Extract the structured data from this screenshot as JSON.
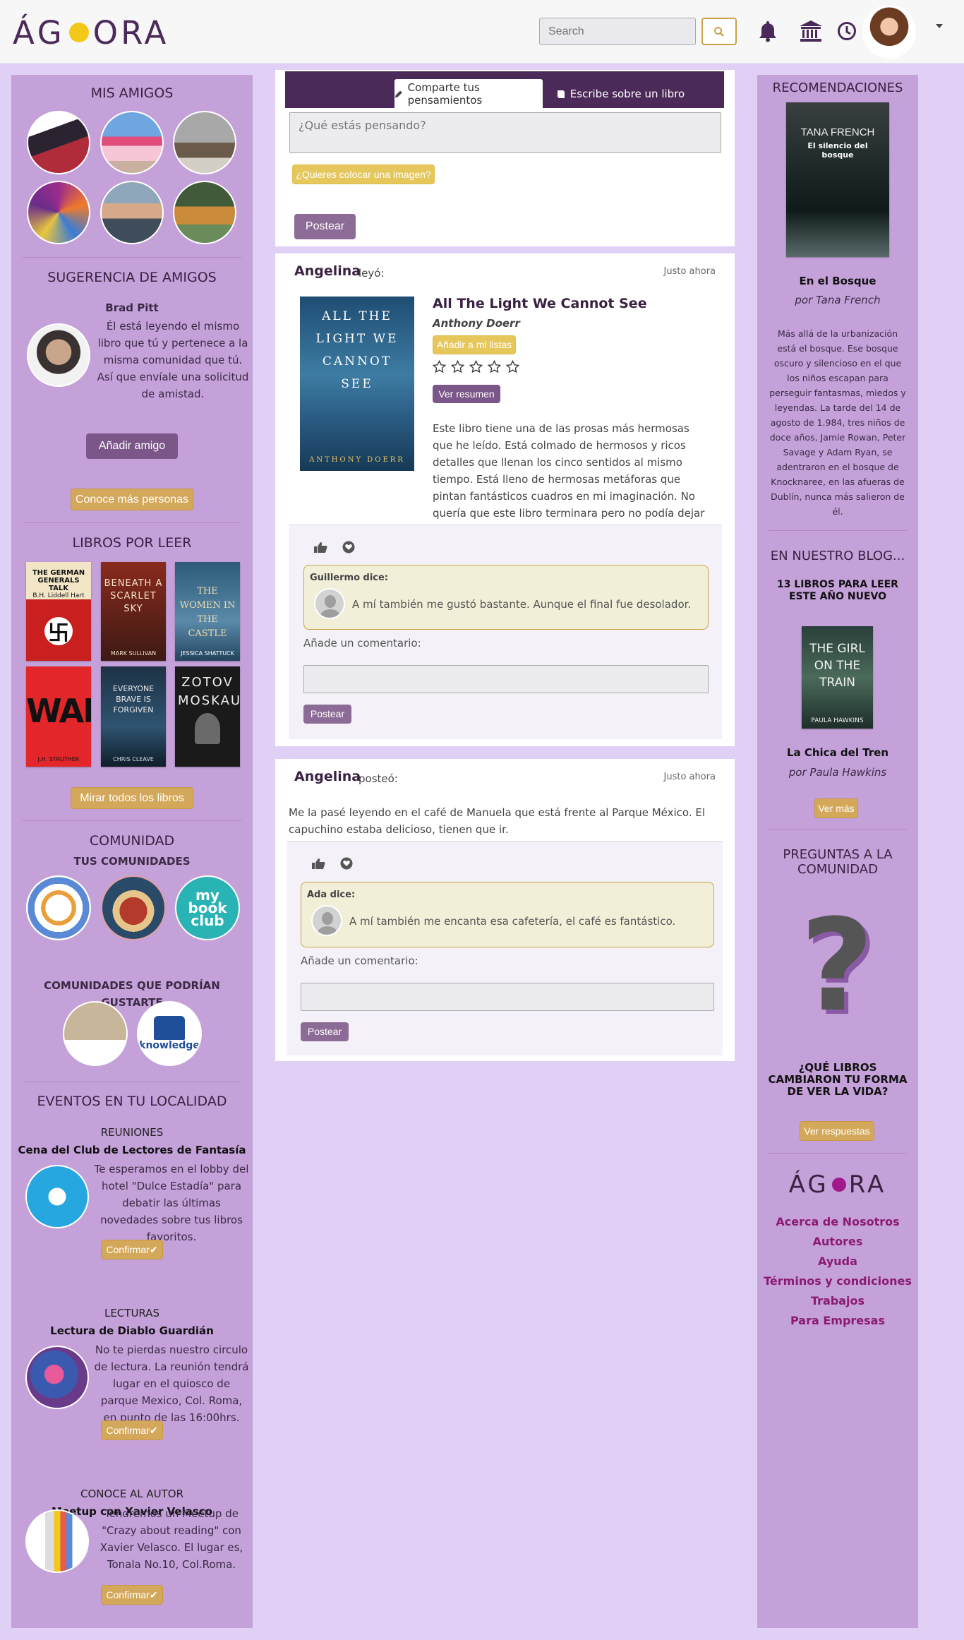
{
  "header": {
    "logo_text_left": "Á",
    "logo_text_right": "ORA",
    "search_placeholder": "Search"
  },
  "left": {
    "friends_title": "MIS AMIGOS",
    "suggest_title": "SUGERENCIA DE AMIGOS",
    "suggest_name": "Brad Pitt",
    "suggest_text": "Él está leyendo el mismo libro que tú y pertenece a la misma comunidad que tú. Así que envíale una solicitud de amistad.",
    "add_friend": "Añadir amigo",
    "meet_more": "Conoce más personas",
    "books_title": "LIBROS POR LEER",
    "books": [
      {
        "title": "THE GERMAN GENERALS TALK",
        "author": "B.H. Liddell Hart"
      },
      {
        "title": "BENEATH A SCARLET SKY",
        "author": "MARK SULLIVAN"
      },
      {
        "title": "THE WOMEN IN THE CASTLE",
        "author": "JESSICA SHATTUCK"
      },
      {
        "title": "WAR",
        "author": "J.H. STRUTHER"
      },
      {
        "title": "EVERYONE BRAVE IS FORGIVEN",
        "author": "CHRIS CLEAVE"
      },
      {
        "title": "ZOTOV MOSKAU",
        "author": ""
      }
    ],
    "see_all_books": "Mirar todos los libros",
    "community_title": "COMUNIDAD",
    "your_communities": "TUS COMUNIDADES",
    "community3_text": "my book club",
    "might_like": "COMUNIDADES QUE PODRÍAN GUSTARTE",
    "community5_text": "knowledge",
    "events_title": "EVENTOS EN TU LOCALIDAD",
    "events": [
      {
        "type": "REUNIONES",
        "name": "Cena del Club de Lectores de Fantasía",
        "text": "Te esperamos en el lobby del hotel \"Dulce Estadía\" para debatir las últimas novedades sobre tus libros favoritos.",
        "btn": "Confirmar✔"
      },
      {
        "type": "LECTURAS",
        "name": "Lectura de Diablo Guardián",
        "text": "No te pierdas nuestro circulo de lectura. La reunión tendrá lugar en el quiosco de parque Mexico, Col. Roma, en punto de las 16:00hrs.",
        "btn": "Confirmar✔"
      },
      {
        "type": "CONOCE AL AUTOR",
        "name": "Meetup con Xavier Velasco",
        "text": "Tendremos un Meetup de \"Crazy about reading\" con Xavier Velasco. El lugar es, Tonala No.10, Col.Roma.",
        "btn": "Confirmar✔"
      }
    ]
  },
  "composer": {
    "tab1": "Comparte tus pensamientos",
    "tab2": "Escribe sobre un libro",
    "placeholder": "¿Qué estás pensando?",
    "image_btn": "¿Quieres colocar una imagen?",
    "post_btn": "Postear"
  },
  "post1": {
    "author": "Angelina",
    "action": "leyó:",
    "time": "Justo ahora",
    "book_title": "All The Light We Cannot See",
    "book_author": "Anthony Doerr",
    "cover_title": "ALL THE LIGHT WE CANNOT SEE",
    "cover_author": "ANTHONY DOERR",
    "add_list": "Añadir a mi listas",
    "rating": 0,
    "summary_btn": "Ver resumen",
    "review": "Este libro tiene una de las prosas más hermosas que he leído. Está colmado de hermosos y ricos detalles que llenan los cinco sentidos al mismo tiempo. Está lleno de hermosas metáforas que pintan fantásticos cuadros en mi imaginación. No quería que este libro terminara pero no podía dejar de leerlo.",
    "comment_author": "Guillermo dice:",
    "comment_text": "A mí también me gustó bastante. Aunque el final fue desolador.",
    "add_comment": "Añade un comentario:",
    "post_btn": "Postear"
  },
  "post2": {
    "author": "Angelina",
    "action": "posteó:",
    "time": "Justo ahora",
    "text": "Me la pasé leyendo en el café de Manuela que está frente al Parque México. El capuchino estaba delicioso, tienen que ir.",
    "comment_author": "Ada dice:",
    "comment_text": "A mí también me encanta esa cafetería, el café es fantástico.",
    "add_comment": "Añade un comentario:",
    "post_btn": "Postear"
  },
  "right": {
    "reco_title": "RECOMENDACIONES",
    "reco_cover_author": "TANA FRENCH",
    "reco_cover_title": "El silencio del bosque",
    "reco_book": "En el Bosque",
    "reco_by": "por Tana French",
    "reco_text": "Más allá de la urbanización está el bosque. Ese bosque oscuro y silencioso en el que los niños escapan para perseguir fantasmas, miedos y leyendas. La tarde del 14 de agosto de 1.984, tres niños de doce años, Jamie Rowan, Peter Savage y Adam Ryan, se adentraron en el bosque de Knocknaree, en las afueras de Dublín, nunca más salieron de él.",
    "blog_title": "EN NUESTRO BLOG...",
    "blog_sub": "13 LIBROS PARA LEER ESTE AÑO NUEVO",
    "blog_cover_title": "THE GIRL ON THE TRAIN",
    "blog_cover_author": "PAULA HAWKINS",
    "blog_book": "La Chica del Tren",
    "blog_by": "por Paula Hawkins",
    "see_more": "Ver más",
    "questions_title": "PREGUNTAS A LA COMUNIDAD",
    "question_text": "¿QUÉ LIBROS CAMBIARON TU FORMA DE VER LA VIDA?",
    "answers_btn": "Ver respuestas",
    "footer_logo_left": "ÁG",
    "footer_logo_right": "RA",
    "links": [
      "Acerca de Nosotros",
      "Autores",
      "Ayuda",
      "Términos y condiciones",
      "Trabajos",
      "Para Empresas"
    ]
  },
  "colors": {
    "accent": "#4b2a59",
    "gold": "#d4a85a",
    "panel": "#c4a1d9",
    "bg": "#e0d0f6",
    "link": "#8b1a73"
  }
}
